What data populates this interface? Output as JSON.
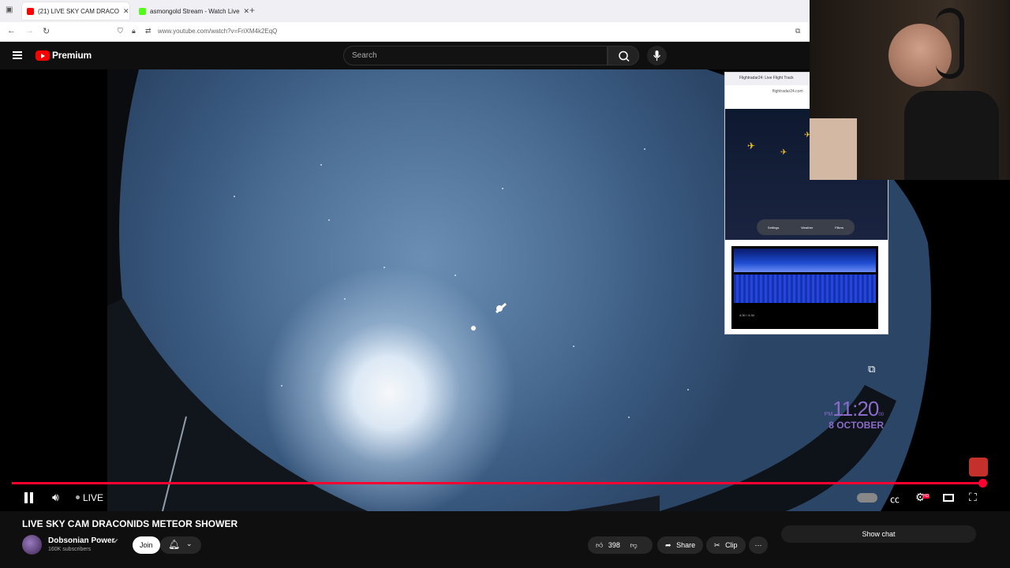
{
  "browser": {
    "tabs": [
      {
        "label": "(21) LIVE SKY CAM DRACO"
      },
      {
        "label": "asmongold Stream - Watch Live"
      }
    ],
    "new_tab": "+",
    "url": "www.youtube.com/watch?v=FriXM4k2EqQ"
  },
  "header": {
    "brand": "Premium",
    "search": {
      "placeholder": "Search"
    }
  },
  "player": {
    "live_label": "LIVE",
    "clock": {
      "ampm": "PM",
      "time": "11:20",
      "seconds": "00",
      "date": "8 OCTOBER"
    },
    "progress_fraction": 1.0
  },
  "popup": {
    "tab_title": "Flightradar24: Live Flight Track",
    "url": "flightradar24.com",
    "map_buttons": [
      "Settings",
      "Weather",
      "Filters"
    ],
    "sdr_time": "4:30 / 4:34"
  },
  "video": {
    "title": "LIVE SKY CAM DRACONIDS METEOR SHOWER",
    "channel": "Dobsonian Power",
    "subscribers": "160K subscribers",
    "join_label": "Join",
    "likes": "398",
    "share_label": "Share",
    "clip_label": "Clip",
    "show_chat_label": "Show chat"
  },
  "colors": {
    "accent": "#ff0033",
    "clock": "#8a6cc8"
  }
}
